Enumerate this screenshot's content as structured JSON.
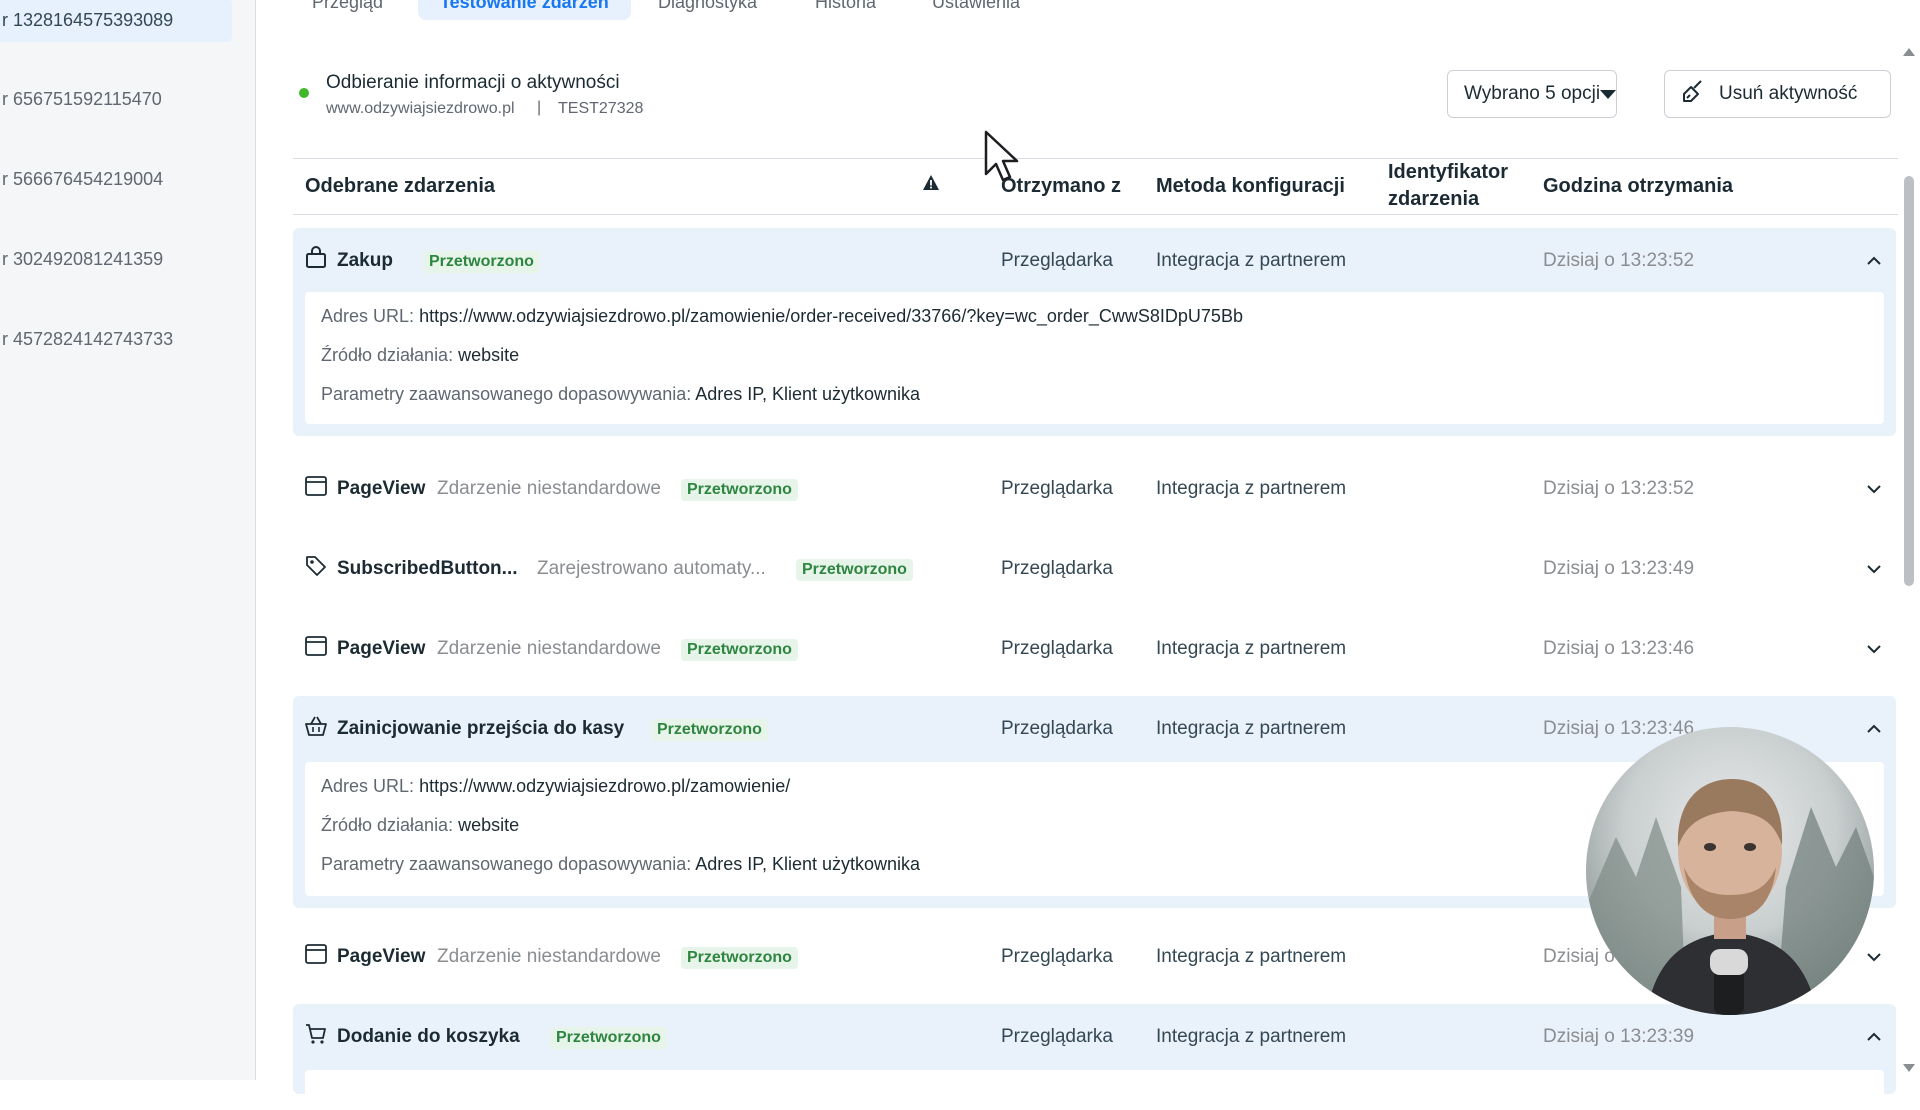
{
  "sidebar": {
    "items": [
      {
        "label": "r 1328164575393089",
        "active": true
      },
      {
        "label": "r 656751592115470",
        "active": false
      },
      {
        "label": "r 566676454219004",
        "active": false
      },
      {
        "label": "r 302492081241359",
        "active": false
      },
      {
        "label": "r 4572824142743733",
        "active": false
      }
    ]
  },
  "tabs": [
    {
      "label": "Przegląd",
      "active": false
    },
    {
      "label": "Testowanie zdarzeń",
      "active": true
    },
    {
      "label": "Diagnostyka",
      "active": false
    },
    {
      "label": "Historia",
      "active": false
    },
    {
      "label": "Ustawienia",
      "active": false
    }
  ],
  "status": {
    "title": "Odbieranie informacji o aktywności",
    "domain": "www.odzywiajsiezdrowo.pl",
    "separator": "|",
    "code": "TEST27328"
  },
  "toolbar": {
    "select_label": "Wybrano 5 opcji",
    "remove_label": "Usuń aktywność"
  },
  "table": {
    "headers": {
      "events": "Odebrane zdarzenia",
      "received_from": "Otrzymano z",
      "config_method": "Metoda konfiguracji",
      "event_id": "Identyfikator zdarzenia",
      "time": "Godzina otrzymania"
    },
    "rows": [
      {
        "icon": "shopping-bag-icon",
        "name": "Zakup",
        "desc": "",
        "status": "Przetworzono",
        "received": "Przeglądarka",
        "method": "Integracja z partnerem",
        "time": "Dzisiaj o 13:23:52",
        "expanded": true,
        "details": [
          {
            "label": "Adres URL:",
            "value": "https://www.odzywiajsiezdrowo.pl/zamowienie/order-received/33766/?key=wc_order_CwwS8IDpU75Bb"
          },
          {
            "label": "Źródło działania:",
            "value": "website"
          },
          {
            "label": "Parametry zaawansowanego dopasowywania:",
            "value": "Adres IP, Klient użytkownika"
          }
        ]
      },
      {
        "icon": "browser-window-icon",
        "name": "PageView",
        "desc": "Zdarzenie niestandardowe",
        "status": "Przetworzono",
        "received": "Przeglądarka",
        "method": "Integracja z partnerem",
        "time": "Dzisiaj o 13:23:52",
        "expanded": false
      },
      {
        "icon": "tag-icon",
        "name": "SubscribedButton...",
        "desc": "Zarejestrowano automaty...",
        "status": "Przetworzono",
        "received": "Przeglądarka",
        "method": "",
        "time": "Dzisiaj o 13:23:49",
        "expanded": false
      },
      {
        "icon": "browser-window-icon",
        "name": "PageView",
        "desc": "Zdarzenie niestandardowe",
        "status": "Przetworzono",
        "received": "Przeglądarka",
        "method": "Integracja z partnerem",
        "time": "Dzisiaj o 13:23:46",
        "expanded": false
      },
      {
        "icon": "basket-icon",
        "name": "Zainicjowanie przejścia do kasy",
        "desc": "",
        "status": "Przetworzono",
        "received": "Przeglądarka",
        "method": "Integracja z partnerem",
        "time": "Dzisiaj o 13:23:46",
        "expanded": true,
        "details": [
          {
            "label": "Adres URL:",
            "value": "https://www.odzywiajsiezdrowo.pl/zamowienie/"
          },
          {
            "label": "Źródło działania:",
            "value": "website"
          },
          {
            "label": "Parametry zaawansowanego dopasowywania:",
            "value": "Adres IP, Klient użytkownika"
          }
        ]
      },
      {
        "icon": "browser-window-icon",
        "name": "PageView",
        "desc": "Zdarzenie niestandardowe",
        "status": "Przetworzono",
        "received": "Przeglądarka",
        "method": "Integracja z partnerem",
        "time": "Dzisiaj o",
        "expanded": false
      },
      {
        "icon": "shopping-cart-icon",
        "name": "Dodanie do koszyka",
        "desc": "",
        "status": "Przetworzono",
        "received": "Przeglądarka",
        "method": "Integracja z partnerem",
        "time": "Dzisiaj o 13:23:39",
        "expanded": true
      }
    ]
  },
  "colors": {
    "accent": "#1877f2",
    "status_green": "#42b72a",
    "badge_green": "#2e8540",
    "expanded_row_bg": "#e9f1fb"
  }
}
